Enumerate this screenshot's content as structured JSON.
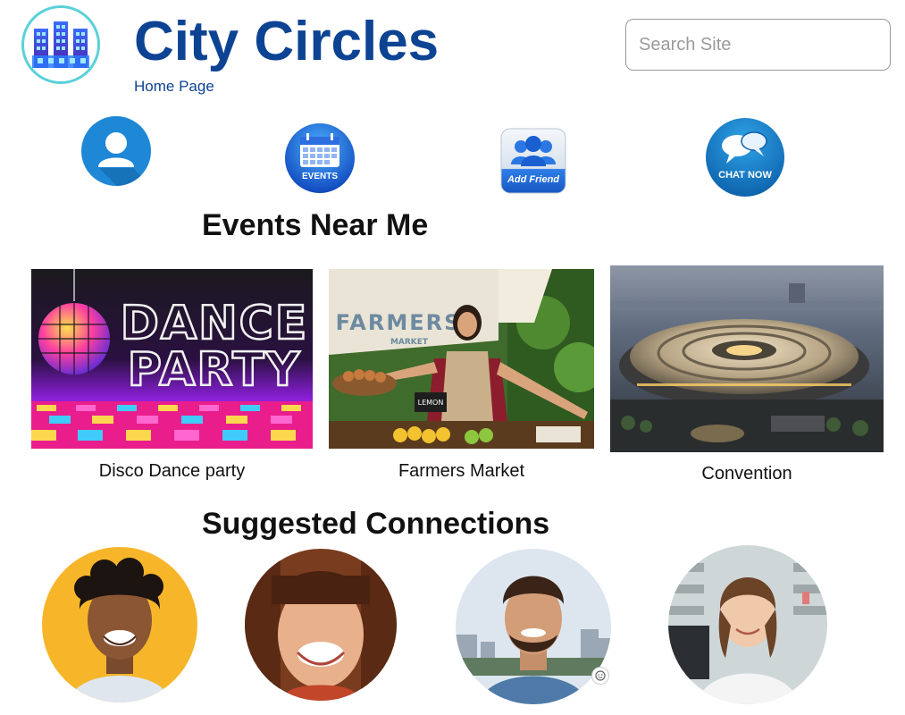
{
  "header": {
    "title": "City Circles",
    "breadcrumb": "Home Page",
    "logo_icon": "city-buildings-logo"
  },
  "search": {
    "placeholder": "Search Site",
    "value": ""
  },
  "quick_actions": [
    {
      "name": "profile",
      "icon": "user-profile-icon"
    },
    {
      "name": "events",
      "icon": "calendar-icon",
      "label": "EVENTS"
    },
    {
      "name": "add_friend",
      "icon": "add-friend-icon",
      "label": "Add Friend"
    },
    {
      "name": "chat",
      "icon": "chat-bubbles-icon",
      "label": "CHAT NOW"
    }
  ],
  "events_section": {
    "heading": "Events Near Me",
    "events": [
      {
        "caption": "Disco Dance party",
        "image_text_line1": "DANCE",
        "image_text_line2": "PARTY"
      },
      {
        "caption": "Farmers Market",
        "image_text_line1": "FARMERS",
        "image_text_line2": "MARKET",
        "sign_text": "LEMON"
      },
      {
        "caption": "Convention"
      }
    ]
  },
  "connections_section": {
    "heading": "Suggested Connections",
    "people": [
      {
        "avatar": "man-curly-hair-avatar"
      },
      {
        "avatar": "woman-bangs-avatar"
      },
      {
        "avatar": "man-denim-shirt-avatar"
      },
      {
        "avatar": "woman-pharmacist-avatar"
      }
    ]
  },
  "colors": {
    "brand_blue": "#0d4393",
    "logo_ring": "#5ad1d9",
    "profile_blue": "#1e88d6"
  }
}
